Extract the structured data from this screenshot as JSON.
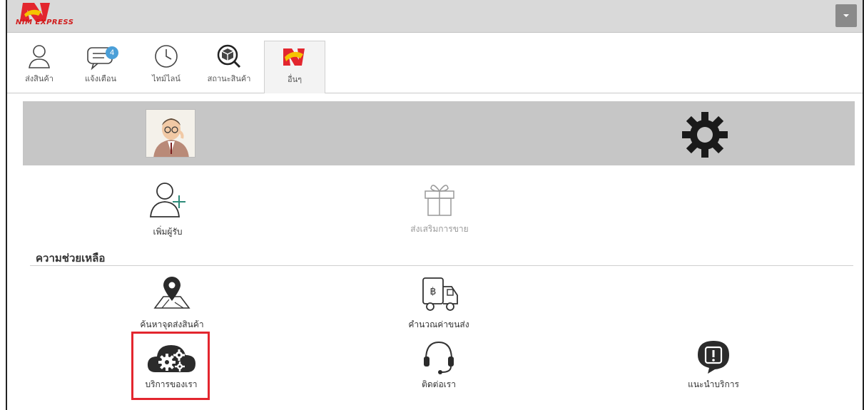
{
  "app": {
    "logo_text": "NIM EXPRESS"
  },
  "tabs": [
    {
      "label": "ส่งสินค้า",
      "icon": "user-icon"
    },
    {
      "label": "แจ้งเตือน",
      "icon": "chat-icon",
      "badge": "4"
    },
    {
      "label": "ไทม์ไลน์",
      "icon": "clock-icon"
    },
    {
      "label": "สถานะสินค้า",
      "icon": "package-search-icon"
    },
    {
      "label": "อื่นๆ",
      "icon": "nim-logo-icon",
      "active": true
    }
  ],
  "profile": {
    "avatar": "avatar-illustration",
    "settings_icon": "gear-icon"
  },
  "actions": [
    {
      "label": "เพิ่มผู้รับ",
      "icon": "add-user-icon"
    },
    {
      "label": "ส่งเสริมการขาย",
      "icon": "gift-icon",
      "disabled": true
    }
  ],
  "help": {
    "title": "ความช่วยเหลือ",
    "items": [
      {
        "label": "ค้นหาจุดส่งสินค้า",
        "icon": "map-pin-icon"
      },
      {
        "label": "คำนวณค่าขนส่ง",
        "icon": "delivery-truck-icon"
      },
      {
        "label": "บริการของเรา",
        "icon": "cloud-gears-icon",
        "highlighted": true
      },
      {
        "label": "ติดต่อเรา",
        "icon": "headset-icon"
      },
      {
        "label": "แนะนำบริการ",
        "icon": "alert-chat-icon"
      }
    ]
  },
  "colors": {
    "brand_red": "#e3262e",
    "brand_yellow": "#f5c400",
    "badge_blue": "#4a9fd8",
    "band_gray": "#c6c6c6"
  }
}
